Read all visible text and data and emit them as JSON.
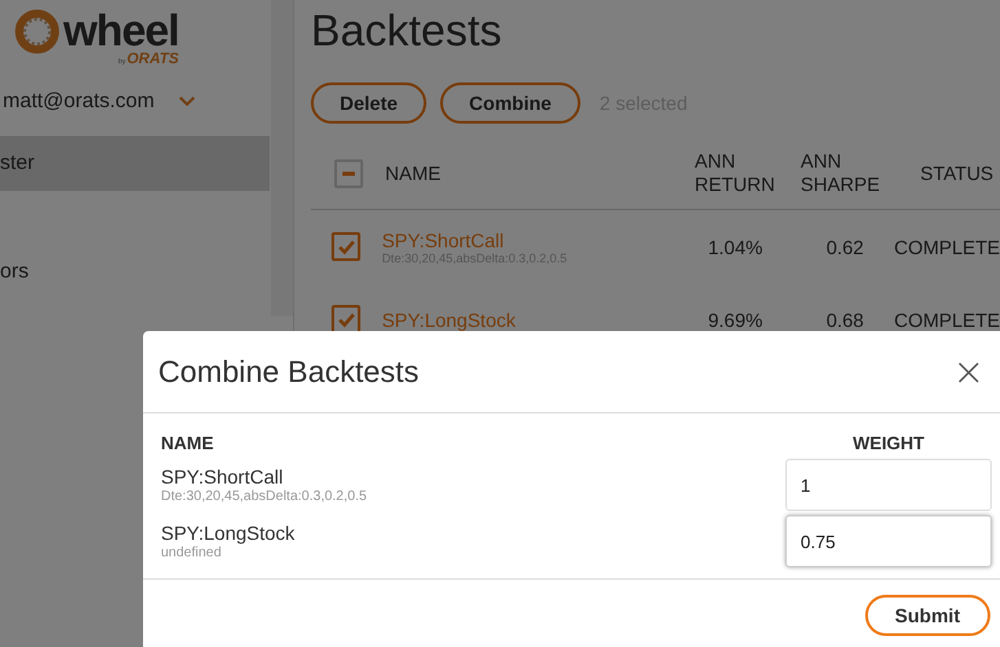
{
  "sidebar": {
    "logo": {
      "word": "wheel",
      "by": "by",
      "brand": "ORATS"
    },
    "user": "matt@orats.com",
    "items": [
      {
        "label": "ster",
        "selected": true
      },
      {
        "label": "ors",
        "selected": false
      }
    ]
  },
  "page": {
    "title": "Backtests",
    "buttons": [
      "Delete",
      "Combine"
    ],
    "selection_count": "2 selected"
  },
  "table": {
    "header_checkbox": {
      "indeterminate": true
    },
    "columns": [
      "NAME",
      "ANN\nRETURN",
      "ANN\nSHARPE",
      "STATUS"
    ],
    "rows": [
      {
        "checked": true,
        "name": "SPY:ShortCall",
        "params": "Dte:30,20,45,absDelta:0.3,0.2,0.5",
        "ann_return": "1.04%",
        "ann_sharpe": "0.62",
        "status": "COMPLETE"
      },
      {
        "checked": true,
        "name": "SPY:LongStock",
        "params": "",
        "ann_return": "9.69%",
        "ann_sharpe": "0.68",
        "status": "COMPLETE"
      }
    ]
  },
  "dialog": {
    "title": "Combine Backtests",
    "close": "×",
    "columns": [
      "NAME",
      "WEIGHT"
    ],
    "rows": [
      {
        "name": "SPY:ShortCall",
        "params": "Dte:30,20,45,absDelta:0.3,0.2,0.5",
        "weight": "1",
        "focused": false
      },
      {
        "name": "SPY:LongStock",
        "params": "undefined",
        "weight": "0.75",
        "focused": true
      }
    ],
    "submit": "Submit"
  }
}
